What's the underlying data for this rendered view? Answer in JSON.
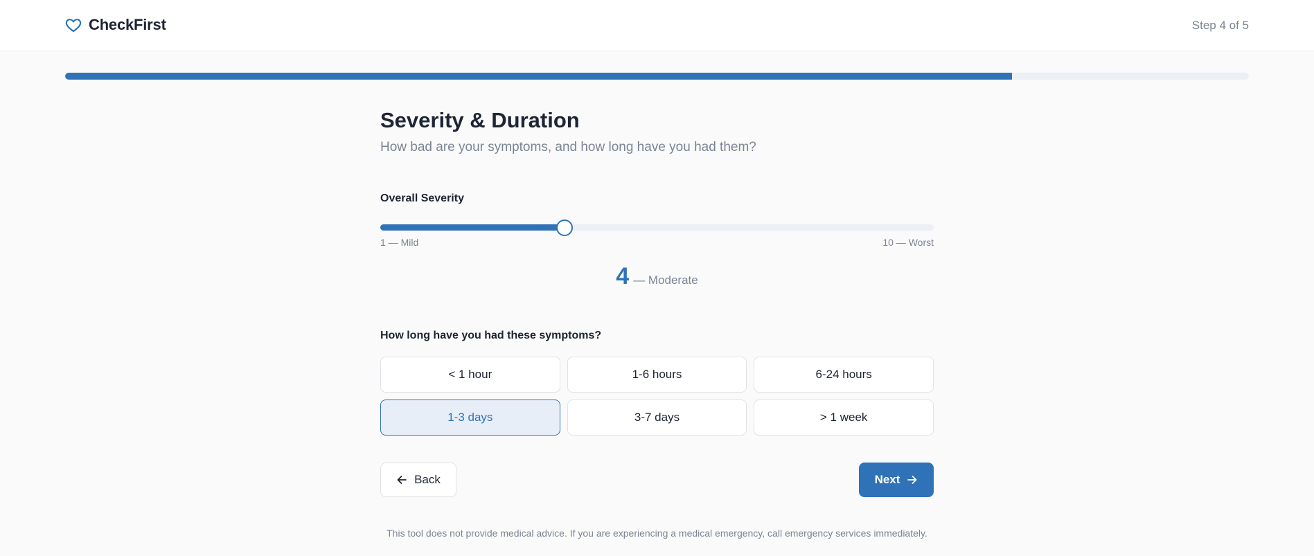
{
  "header": {
    "brand_name": "CheckFirst",
    "brand_icon": "heart-icon",
    "step_indicator": "Step 4 of 5"
  },
  "progress": {
    "fraction": 0.8,
    "color": "#2f72b8"
  },
  "main": {
    "title": "Severity & Duration",
    "subtitle": "How bad are your symptoms, and how long have you had them?"
  },
  "severity": {
    "label": "Overall Severity",
    "min": 1,
    "max": 10,
    "value": 4,
    "value_text": "4",
    "value_desc": "— Moderate",
    "min_label": "1 — Mild",
    "max_label": "10 — Worst"
  },
  "duration": {
    "label": "How long have you had these symptoms?",
    "options": [
      "< 1 hour",
      "1-6 hours",
      "6-24 hours",
      "1-3 days",
      "3-7 days",
      "> 1 week"
    ],
    "selected_index": 3
  },
  "nav": {
    "back_label": "Back",
    "back_icon": "arrow-left-icon",
    "next_label": "Next",
    "next_icon": "arrow-right-icon"
  },
  "disclaimer": "This tool does not provide medical advice. If you are experiencing a medical emergency, call emergency services immediately.",
  "colors": {
    "accent": "#2f72b8",
    "text": "#1e2433",
    "muted": "#7b8494"
  }
}
